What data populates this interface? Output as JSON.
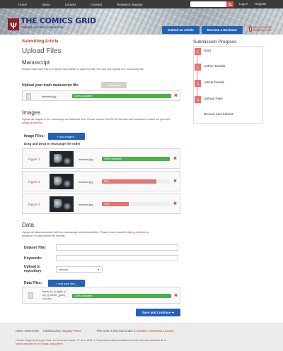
{
  "nav": {
    "links": [
      "Home",
      "About",
      "Contact",
      "Content",
      "Research Integrity"
    ],
    "login": "Log in",
    "register": "Register"
  },
  "header": {
    "logo_letter": "ψ",
    "title": "THE COMICS GRID",
    "subtitle": "Journal of comics scholarship",
    "submit_button": "Submit an Article",
    "reviewer_button": "Become a Reviewer",
    "oa_text": [
      "OPEN ACCESS",
      "SOME ACCESS"
    ]
  },
  "main": {
    "section": "Submitting Article",
    "page_title": "Upload Files",
    "manuscript": {
      "heading": "Manuscript",
      "description": "Please make sure this is in Word, OpenOffice or Latex format. You can only upload one manuscript file.",
      "label": "Upload your main manuscript file:",
      "upload_button": "Upload file",
      "file": {
        "name": "imasted.jpg",
        "progress_label": "100% uploaded!",
        "progress": 1.0
      }
    },
    "images": {
      "heading": "Images",
      "description_pre": "Upload all images in the manuscript as individual files. Please ensure that the file formats and resolutions match the journal's ",
      "description_link": "image guidelines",
      "description_post": ".",
      "label": "Image Files:",
      "add_button": "+ Add images...",
      "reorder_note": "Drag and Drop to rearrange the order",
      "figures": [
        {
          "label": "Figure 1.",
          "name": "imasted.jpg",
          "progress_label": "100% uploaded!",
          "progress": 1.0,
          "status": "complete"
        },
        {
          "label": "Figure 2.",
          "name": "imasted.jpg",
          "progress_label": "80%",
          "progress": 0.8,
          "status": "uploading"
        },
        {
          "label": "Figure 3.",
          "name": "imasted.jpg",
          "progress_label": "40%",
          "progress": 0.4,
          "status": "uploading"
        }
      ]
    },
    "data": {
      "heading": "Data",
      "description_pre": "Upload all data associated with the manuscript as individual files. Please check journal's ",
      "description_link": "data guidelines",
      "description_post": " for guidance on appropriate file formats.",
      "dataset_title_label": "Dataset Title:",
      "keywords_label": "Keywords:",
      "upload_repo_label_1": "Upload to",
      "upload_repo_label_2": "repository",
      "repository_value": "zebodo",
      "files_label": "Data Files:",
      "add_button": "+ Add data files...",
      "file": {
        "name_lines": [
          "there_is_a_light_a",
          "nd_it_never_goes_",
          "out.doc"
        ],
        "progress_label": "100% uploaded!",
        "progress": 1.0
      }
    },
    "save_button": "Save and Continue ➜"
  },
  "sidebar": {
    "title": "Submission Progress",
    "steps": [
      {
        "num": "1",
        "name": "Start",
        "state": "done"
      },
      {
        "num": "2",
        "name": "Author Details",
        "state": "done"
      },
      {
        "num": "3",
        "name": "Article Details",
        "state": "done"
      },
      {
        "num": "4",
        "name": "Upload Files",
        "state": "current"
      },
      {
        "num": "",
        "name": "Review and Submit",
        "state": "todo"
      }
    ]
  },
  "footer": {
    "issn": "ISSN: 2048-0792",
    "publisher_pre": "Published by ",
    "publisher_link": "Ubiquity Press",
    "license_pre": "This work is licensed under a ",
    "license_link": "Creative Commons License",
    "license_post": ".",
    "credits_pre": "Header image by Georges Ortiz, La Jeunesse Illustré, 17 June 1906, 1. Reproduced with permission from the ",
    "credits_link": "Cité Internationale de la bande dessinée et de l'image, Angoulême",
    "credits_post": "."
  },
  "colors": {
    "accent_red": "#c0392b",
    "button_blue": "#2262b8",
    "progress_green": "#4cae4c",
    "progress_red": "#e57373"
  }
}
